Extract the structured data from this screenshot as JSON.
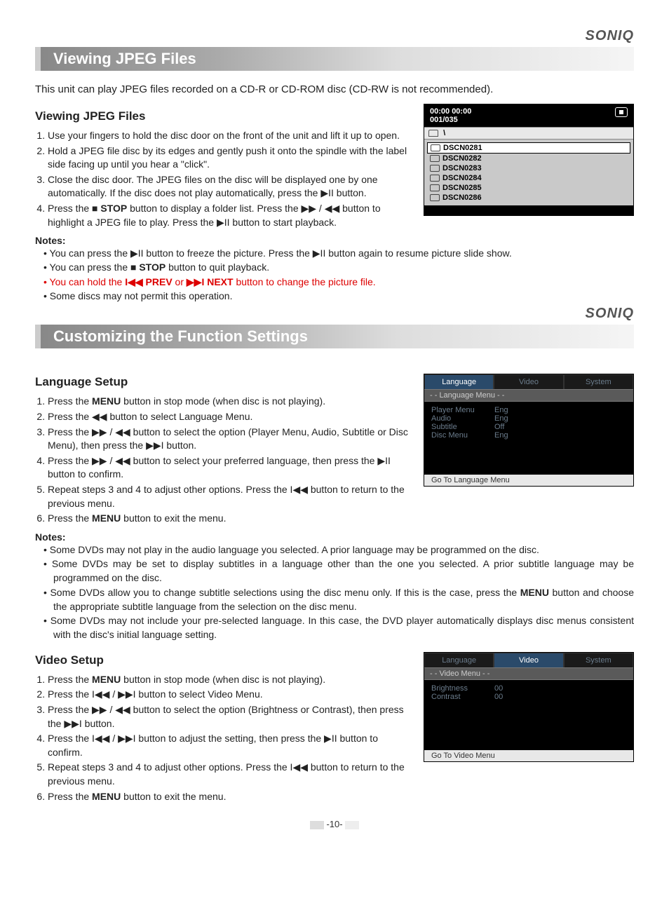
{
  "brand": "SONIQ",
  "page_number": "-10-",
  "section1": {
    "title": "Viewing JPEG Files",
    "intro": "This unit can play JPEG files recorded on a CD-R or CD-ROM disc (CD-RW is not recommended).",
    "heading": "Viewing JPEG Files",
    "steps": {
      "s1": "Use your fingers to hold the disc door on the front of the unit and lift it up to open.",
      "s2": "Hold a JPEG file disc by its edges and gently push it onto the spindle with the label side facing up until you hear a \"click\".",
      "s3": "Close the disc door. The JPEG files on the disc will be displayed one by one automatically. If the disc does not play automatically, press the ▶II button.",
      "s4a": "Press the ",
      "s4b": "■ STOP",
      "s4c": " button to display a folder list. Press the ▶▶ / ◀◀ button to highlight a JPEG file to play. Press the ▶II button to start playback."
    },
    "notes_heading": "Notes:",
    "notes": {
      "n1": "You can press the ▶II button to freeze the picture. Press the ▶II button again to resume picture slide show.",
      "n2a": "You can press the ",
      "n2b": "■ STOP",
      "n2c": " button to quit playback.",
      "n3a": "You can hold the  ",
      "n3b": "I◀◀ PREV",
      "n3c": " or ",
      "n3d": "▶▶I NEXT",
      "n3e": " button to change the picture file.",
      "n4": "Some discs may not permit this operation."
    }
  },
  "osd_jpeg": {
    "time": "00:00    00:00",
    "counter": "001/035",
    "path": "\\",
    "files": [
      "DSCN0281",
      "DSCN0282",
      "DSCN0283",
      "DSCN0284",
      "DSCN0285",
      "DSCN0286"
    ]
  },
  "section2": {
    "title": "Customizing the Function Settings",
    "lang_heading": "Language Setup",
    "lang_steps": {
      "s1a": "Press the ",
      "s1b": "MENU",
      "s1c": " button in stop mode (when disc is not playing).",
      "s2": "Press the ◀◀ button to select Language Menu.",
      "s3": "Press the ▶▶ / ◀◀ button to select the option (Player Menu, Audio, Subtitle or Disc Menu), then press the ▶▶I button.",
      "s4": "Press the ▶▶ / ◀◀ button to select your preferred language, then press the ▶II button to confirm.",
      "s5": "Repeat steps 3 and 4 to adjust other options. Press the I◀◀ button to return to the previous menu.",
      "s6a": "Press the ",
      "s6b": "MENU",
      "s6c": " button to exit the menu."
    },
    "lang_notes_heading": "Notes:",
    "lang_notes": {
      "n1": "Some DVDs may not play in the audio language you selected. A prior language may be programmed on the disc.",
      "n2": "Some DVDs may be set to display subtitles in a language other than the one you selected. A prior subtitle language may be programmed on the disc.",
      "n3a": "Some DVDs allow you to change subtitle selections using the disc menu only. If this is the case, press the ",
      "n3b": "MENU",
      "n3c": " button and choose the appropriate subtitle language from the selection on the disc menu.",
      "n4": "Some DVDs may not include your pre-selected language. In this case, the DVD player automatically displays disc menus consistent with the disc's initial language setting."
    },
    "video_heading": "Video Setup",
    "video_steps": {
      "s1a": "Press the ",
      "s1b": "MENU",
      "s1c": " button in stop mode (when disc is not playing).",
      "s2": "Press the I◀◀ / ▶▶I button to select Video Menu.",
      "s3": "Press the ▶▶ / ◀◀ button to select the option (Brightness or Contrast), then press the ▶▶I button.",
      "s4": "Press the I◀◀ / ▶▶I button to adjust the setting, then press the ▶II button to confirm.",
      "s5": "Repeat steps 3 and 4 to adjust other options. Press the I◀◀ button to return to the previous menu.",
      "s6a": "Press the ",
      "s6b": "MENU",
      "s6c": " button to exit the menu."
    }
  },
  "osd_lang": {
    "tabs": {
      "t1": "Language",
      "t2": "Video",
      "t3": "System"
    },
    "subtitle": "- -  Language Menu  - -",
    "rows": [
      {
        "k": "Player Menu",
        "v": "Eng"
      },
      {
        "k": "Audio",
        "v": "Eng"
      },
      {
        "k": "Subtitle",
        "v": "Off"
      },
      {
        "k": "Disc  Menu",
        "v": "Eng"
      }
    ],
    "footer": "Go  To Language Menu"
  },
  "osd_video": {
    "tabs": {
      "t1": "Language",
      "t2": "Video",
      "t3": "System"
    },
    "subtitle": "- -  Video Menu - -",
    "rows": [
      {
        "k": "Brightness",
        "v": "00"
      },
      {
        "k": "Contrast",
        "v": "00"
      }
    ],
    "footer": "Go To Video Menu"
  }
}
